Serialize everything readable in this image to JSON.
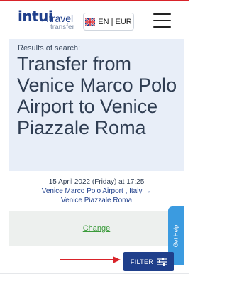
{
  "header": {
    "logo_main": "intui",
    "logo_travel": ".travel",
    "logo_sub": "transfer",
    "lang_label": "EN | EUR",
    "flag_icon": "uk-flag-icon",
    "menu_icon": "hamburger-menu-icon"
  },
  "hero": {
    "results_label": "Results of search:",
    "title": "Transfer from Venice Marco Polo Airport to Venice Piazzale Roma"
  },
  "trip": {
    "date": "15 April 2022 (Friday) at 17:25",
    "route_line1": "Venice Marco Polo Airport , Italy →",
    "route_line2": "Venice Piazzale Roma"
  },
  "actions": {
    "change_label": "Change",
    "filter_label": "FILTER",
    "filter_icon": "sliders-icon",
    "help_label": "Get Help",
    "arrow_icon": "red-arrow-right-icon"
  },
  "colors": {
    "brand": "#1f3f8b",
    "accent_red": "#d9232a",
    "hero_bg": "#e8eef8",
    "change_green": "#3b9b3b",
    "help_blue": "#3b9be0"
  }
}
